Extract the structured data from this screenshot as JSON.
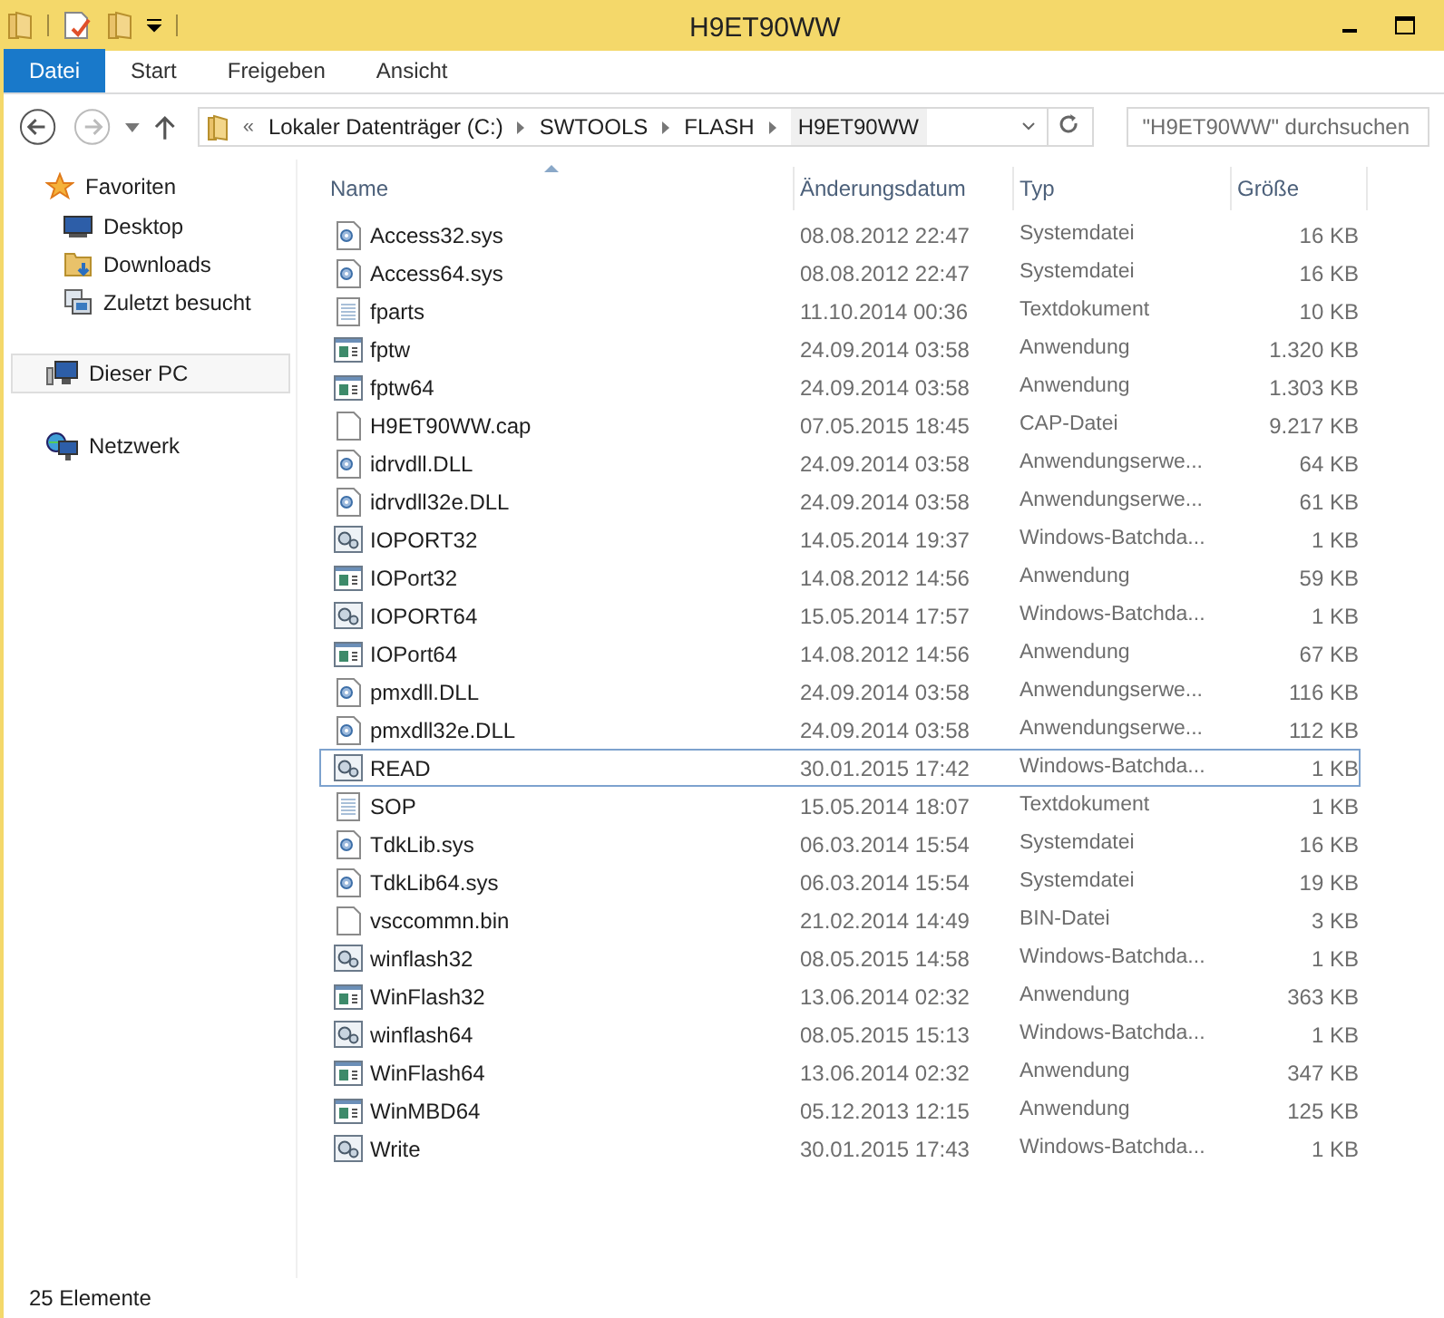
{
  "window": {
    "title": "H9ET90WW"
  },
  "ribbon_tabs": [
    {
      "label": "Datei",
      "selected": true
    },
    {
      "label": "Start",
      "selected": false
    },
    {
      "label": "Freigeben",
      "selected": false
    },
    {
      "label": "Ansicht",
      "selected": false
    }
  ],
  "address_bar": {
    "overflow": "«",
    "crumbs": [
      "Lokaler Datenträger (C:)",
      "SWTOOLS",
      "FLASH",
      "H9ET90WW"
    ]
  },
  "search": {
    "placeholder": "\"H9ET90WW\" durchsuchen"
  },
  "sidebar": {
    "groups": [
      {
        "label": "Favoriten",
        "kind": "star",
        "selected": false,
        "children": [
          {
            "label": "Desktop",
            "kind": "desktop"
          },
          {
            "label": "Downloads",
            "kind": "downloads"
          },
          {
            "label": "Zuletzt besucht",
            "kind": "recent"
          }
        ]
      },
      {
        "label": "Dieser PC",
        "kind": "pc",
        "selected": true
      },
      {
        "label": "Netzwerk",
        "kind": "network",
        "selected": false
      }
    ]
  },
  "table": {
    "columns": [
      "Name",
      "Änderungsdatum",
      "Typ",
      "Größe"
    ],
    "rows": [
      {
        "name": "Access32.sys",
        "date": "08.08.2012 22:47",
        "type": "Systemdatei",
        "size": "16 KB",
        "kind": "sys",
        "selected": false
      },
      {
        "name": "Access64.sys",
        "date": "08.08.2012 22:47",
        "type": "Systemdatei",
        "size": "16 KB",
        "kind": "sys",
        "selected": false
      },
      {
        "name": "fparts",
        "date": "11.10.2014 00:36",
        "type": "Textdokument",
        "size": "10 KB",
        "kind": "text",
        "selected": false
      },
      {
        "name": "fptw",
        "date": "24.09.2014 03:58",
        "type": "Anwendung",
        "size": "1.320 KB",
        "kind": "app",
        "selected": false
      },
      {
        "name": "fptw64",
        "date": "24.09.2014 03:58",
        "type": "Anwendung",
        "size": "1.303 KB",
        "kind": "app",
        "selected": false
      },
      {
        "name": "H9ET90WW.cap",
        "date": "07.05.2015 18:45",
        "type": "CAP-Datei",
        "size": "9.217 KB",
        "kind": "blank",
        "selected": false
      },
      {
        "name": "idrvdll.DLL",
        "date": "24.09.2014 03:58",
        "type": "Anwendungserwe...",
        "size": "64 KB",
        "kind": "sys",
        "selected": false
      },
      {
        "name": "idrvdll32e.DLL",
        "date": "24.09.2014 03:58",
        "type": "Anwendungserwe...",
        "size": "61 KB",
        "kind": "sys",
        "selected": false
      },
      {
        "name": "IOPORT32",
        "date": "14.05.2014 19:37",
        "type": "Windows-Batchda...",
        "size": "1 KB",
        "kind": "batch",
        "selected": false
      },
      {
        "name": "IOPort32",
        "date": "14.08.2012 14:56",
        "type": "Anwendung",
        "size": "59 KB",
        "kind": "app",
        "selected": false
      },
      {
        "name": "IOPORT64",
        "date": "15.05.2014 17:57",
        "type": "Windows-Batchda...",
        "size": "1 KB",
        "kind": "batch",
        "selected": false
      },
      {
        "name": "IOPort64",
        "date": "14.08.2012 14:56",
        "type": "Anwendung",
        "size": "67 KB",
        "kind": "app",
        "selected": false
      },
      {
        "name": "pmxdll.DLL",
        "date": "24.09.2014 03:58",
        "type": "Anwendungserwe...",
        "size": "116 KB",
        "kind": "sys",
        "selected": false
      },
      {
        "name": "pmxdll32e.DLL",
        "date": "24.09.2014 03:58",
        "type": "Anwendungserwe...",
        "size": "112 KB",
        "kind": "sys",
        "selected": false
      },
      {
        "name": "READ",
        "date": "30.01.2015 17:42",
        "type": "Windows-Batchda...",
        "size": "1 KB",
        "kind": "batch",
        "selected": true
      },
      {
        "name": "SOP",
        "date": "15.05.2014 18:07",
        "type": "Textdokument",
        "size": "1 KB",
        "kind": "text",
        "selected": false
      },
      {
        "name": "TdkLib.sys",
        "date": "06.03.2014 15:54",
        "type": "Systemdatei",
        "size": "16 KB",
        "kind": "sys",
        "selected": false
      },
      {
        "name": "TdkLib64.sys",
        "date": "06.03.2014 15:54",
        "type": "Systemdatei",
        "size": "19 KB",
        "kind": "sys",
        "selected": false
      },
      {
        "name": "vsccommn.bin",
        "date": "21.02.2014 14:49",
        "type": "BIN-Datei",
        "size": "3 KB",
        "kind": "blank",
        "selected": false
      },
      {
        "name": "winflash32",
        "date": "08.05.2015 14:58",
        "type": "Windows-Batchda...",
        "size": "1 KB",
        "kind": "batch",
        "selected": false
      },
      {
        "name": "WinFlash32",
        "date": "13.06.2014 02:32",
        "type": "Anwendung",
        "size": "363 KB",
        "kind": "app",
        "selected": false
      },
      {
        "name": "winflash64",
        "date": "08.05.2015 15:13",
        "type": "Windows-Batchda...",
        "size": "1 KB",
        "kind": "batch",
        "selected": false
      },
      {
        "name": "WinFlash64",
        "date": "13.06.2014 02:32",
        "type": "Anwendung",
        "size": "347 KB",
        "kind": "app",
        "selected": false
      },
      {
        "name": "WinMBD64",
        "date": "05.12.2013 12:15",
        "type": "Anwendung",
        "size": "125 KB",
        "kind": "app",
        "selected": false
      },
      {
        "name": "Write",
        "date": "30.01.2015 17:43",
        "type": "Windows-Batchda...",
        "size": "1 KB",
        "kind": "batch",
        "selected": false
      }
    ]
  },
  "status_bar": {
    "count": "25 Elemente"
  }
}
